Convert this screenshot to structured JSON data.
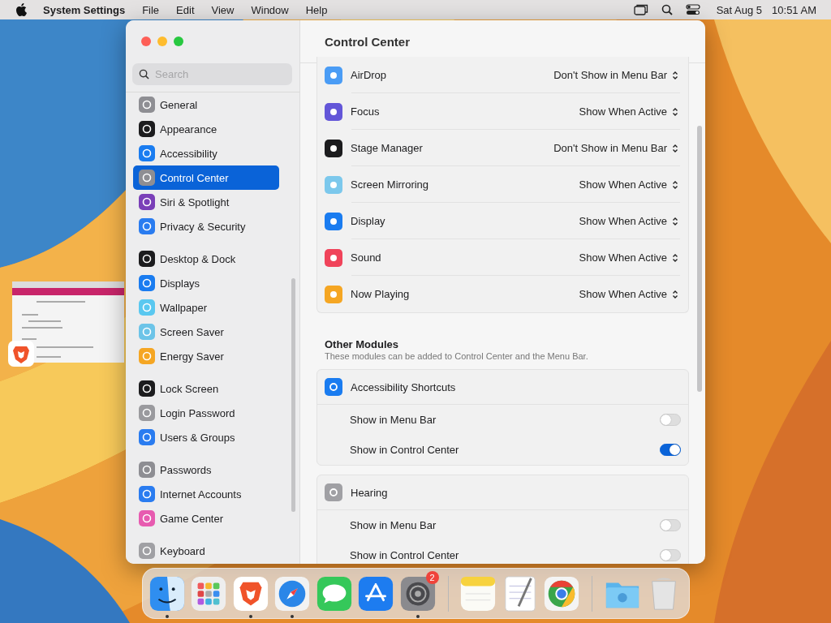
{
  "menu_bar": {
    "app_name": "System Settings",
    "menus": [
      "File",
      "Edit",
      "View",
      "Window",
      "Help"
    ],
    "date": "Sat Aug 5",
    "time": "10:51 AM"
  },
  "window": {
    "title": "Control Center",
    "sidebar": {
      "search": {
        "placeholder": "Search"
      },
      "groups": [
        [
          {
            "label": "General",
            "color": "#8e8e93",
            "selected": false
          },
          {
            "label": "Appearance",
            "color": "#1c1c1e",
            "selected": false
          },
          {
            "label": "Accessibility",
            "color": "#1a7cf0",
            "selected": false
          },
          {
            "label": "Control Center",
            "color": "#8e8e93",
            "selected": true
          },
          {
            "label": "Siri & Spotlight",
            "color": "#7a3fb8",
            "selected": false
          },
          {
            "label": "Privacy & Security",
            "color": "#2a7cf0",
            "selected": false
          }
        ],
        [
          {
            "label": "Desktop & Dock",
            "color": "#1c1c1e",
            "selected": false
          },
          {
            "label": "Displays",
            "color": "#1a7cf0",
            "selected": false
          },
          {
            "label": "Wallpaper",
            "color": "#5ac8f0",
            "selected": false
          },
          {
            "label": "Screen Saver",
            "color": "#6cc4e8",
            "selected": false
          },
          {
            "label": "Energy Saver",
            "color": "#f5a623",
            "selected": false
          }
        ],
        [
          {
            "label": "Lock Screen",
            "color": "#1c1c1e",
            "selected": false
          },
          {
            "label": "Login Password",
            "color": "#9a9a9e",
            "selected": false
          },
          {
            "label": "Users & Groups",
            "color": "#2a7cf0",
            "selected": false
          }
        ],
        [
          {
            "label": "Passwords",
            "color": "#8e8e93",
            "selected": false
          },
          {
            "label": "Internet Accounts",
            "color": "#2a7cf0",
            "selected": false
          },
          {
            "label": "Game Center",
            "color": "#e75bb0",
            "selected": false
          }
        ],
        [
          {
            "label": "Keyboard",
            "color": "#a0a0a4",
            "selected": false
          }
        ]
      ]
    },
    "modules": [
      {
        "name": "AirDrop",
        "color": "#4a9cf5",
        "value": "Don't Show in Menu Bar"
      },
      {
        "name": "Focus",
        "color": "#6356d8",
        "value": "Show When Active"
      },
      {
        "name": "Stage Manager",
        "color": "#1c1c1e",
        "value": "Don't Show in Menu Bar"
      },
      {
        "name": "Screen Mirroring",
        "color": "#7cc8ec",
        "value": "Show When Active"
      },
      {
        "name": "Display",
        "color": "#1a7cf0",
        "value": "Show When Active"
      },
      {
        "name": "Sound",
        "color": "#f0435a",
        "value": "Show When Active"
      },
      {
        "name": "Now Playing",
        "color": "#f5a623",
        "value": "Show When Active"
      }
    ],
    "other_modules": {
      "title": "Other Modules",
      "subtitle": "These modules can be added to Control Center and the Menu Bar.",
      "items": [
        {
          "name": "Accessibility Shortcuts",
          "color": "#1a7cf0",
          "options": [
            {
              "label": "Show in Menu Bar",
              "on": false
            },
            {
              "label": "Show in Control Center",
              "on": true
            }
          ]
        },
        {
          "name": "Hearing",
          "color": "#a0a0a4",
          "options": [
            {
              "label": "Show in Menu Bar",
              "on": false
            },
            {
              "label": "Show in Control Center",
              "on": false
            }
          ]
        }
      ]
    }
  },
  "dock": [
    {
      "kind": "finder",
      "running": true
    },
    {
      "kind": "launchpad",
      "running": false
    },
    {
      "kind": "brave",
      "running": true
    },
    {
      "kind": "safari",
      "running": true
    },
    {
      "kind": "messages",
      "running": false
    },
    {
      "kind": "appstore",
      "running": false
    },
    {
      "kind": "settings",
      "running": true,
      "badge": "2"
    },
    {
      "kind": "separator"
    },
    {
      "kind": "notes",
      "running": false
    },
    {
      "kind": "textedit",
      "running": false
    },
    {
      "kind": "chrome",
      "running": false
    },
    {
      "kind": "separator"
    },
    {
      "kind": "downloads",
      "running": false
    },
    {
      "kind": "trash",
      "running": false
    }
  ]
}
